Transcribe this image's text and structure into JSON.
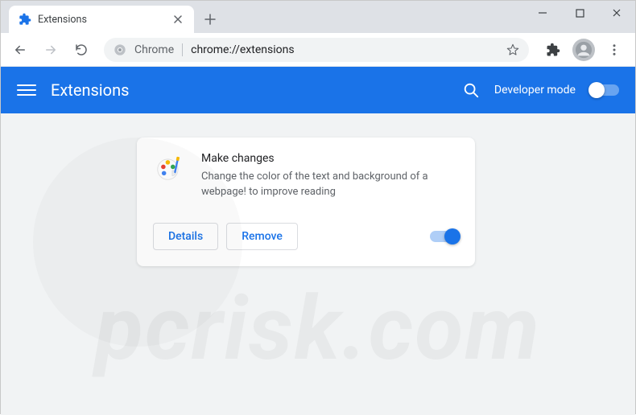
{
  "tab": {
    "title": "Extensions"
  },
  "omnibox": {
    "chrome_label": "Chrome",
    "url": "chrome://extensions"
  },
  "app_header": {
    "title": "Extensions",
    "developer_mode_label": "Developer mode"
  },
  "extension": {
    "name": "Make changes",
    "description": "Change the color of the text and background of a webpage! to improve reading",
    "details_label": "Details",
    "remove_label": "Remove",
    "enabled": true
  },
  "developer_mode_enabled": false,
  "icons": {
    "puzzle": "puzzle-icon",
    "close": "close-icon",
    "plus": "plus-icon",
    "minimize": "minimize-icon",
    "maximize": "maximize-icon",
    "window_close": "window-close-icon",
    "back": "back-icon",
    "forward": "forward-icon",
    "reload": "reload-icon",
    "chrome": "chrome-icon",
    "star": "star-icon",
    "extensions": "extensions-icon",
    "account": "account-icon",
    "kebab": "kebab-icon",
    "hamburger": "hamburger-icon",
    "search": "search-icon",
    "palette": "palette-icon"
  },
  "watermark": "pcrisk.com"
}
